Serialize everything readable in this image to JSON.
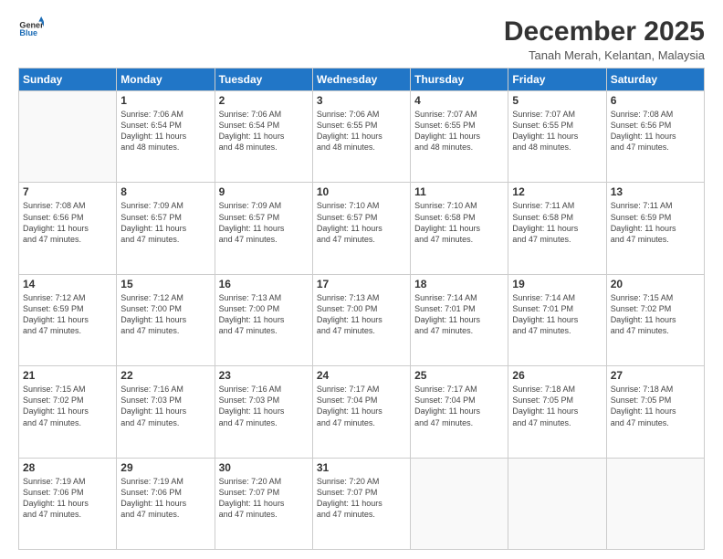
{
  "logo": {
    "line1": "General",
    "line2": "Blue"
  },
  "header": {
    "title": "December 2025",
    "subtitle": "Tanah Merah, Kelantan, Malaysia"
  },
  "weekdays": [
    "Sunday",
    "Monday",
    "Tuesday",
    "Wednesday",
    "Thursday",
    "Friday",
    "Saturday"
  ],
  "weeks": [
    [
      {
        "day": "",
        "info": ""
      },
      {
        "day": "1",
        "info": "Sunrise: 7:06 AM\nSunset: 6:54 PM\nDaylight: 11 hours\nand 48 minutes."
      },
      {
        "day": "2",
        "info": "Sunrise: 7:06 AM\nSunset: 6:54 PM\nDaylight: 11 hours\nand 48 minutes."
      },
      {
        "day": "3",
        "info": "Sunrise: 7:06 AM\nSunset: 6:55 PM\nDaylight: 11 hours\nand 48 minutes."
      },
      {
        "day": "4",
        "info": "Sunrise: 7:07 AM\nSunset: 6:55 PM\nDaylight: 11 hours\nand 48 minutes."
      },
      {
        "day": "5",
        "info": "Sunrise: 7:07 AM\nSunset: 6:55 PM\nDaylight: 11 hours\nand 48 minutes."
      },
      {
        "day": "6",
        "info": "Sunrise: 7:08 AM\nSunset: 6:56 PM\nDaylight: 11 hours\nand 47 minutes."
      }
    ],
    [
      {
        "day": "7",
        "info": "Sunrise: 7:08 AM\nSunset: 6:56 PM\nDaylight: 11 hours\nand 47 minutes."
      },
      {
        "day": "8",
        "info": "Sunrise: 7:09 AM\nSunset: 6:57 PM\nDaylight: 11 hours\nand 47 minutes."
      },
      {
        "day": "9",
        "info": "Sunrise: 7:09 AM\nSunset: 6:57 PM\nDaylight: 11 hours\nand 47 minutes."
      },
      {
        "day": "10",
        "info": "Sunrise: 7:10 AM\nSunset: 6:57 PM\nDaylight: 11 hours\nand 47 minutes."
      },
      {
        "day": "11",
        "info": "Sunrise: 7:10 AM\nSunset: 6:58 PM\nDaylight: 11 hours\nand 47 minutes."
      },
      {
        "day": "12",
        "info": "Sunrise: 7:11 AM\nSunset: 6:58 PM\nDaylight: 11 hours\nand 47 minutes."
      },
      {
        "day": "13",
        "info": "Sunrise: 7:11 AM\nSunset: 6:59 PM\nDaylight: 11 hours\nand 47 minutes."
      }
    ],
    [
      {
        "day": "14",
        "info": "Sunrise: 7:12 AM\nSunset: 6:59 PM\nDaylight: 11 hours\nand 47 minutes."
      },
      {
        "day": "15",
        "info": "Sunrise: 7:12 AM\nSunset: 7:00 PM\nDaylight: 11 hours\nand 47 minutes."
      },
      {
        "day": "16",
        "info": "Sunrise: 7:13 AM\nSunset: 7:00 PM\nDaylight: 11 hours\nand 47 minutes."
      },
      {
        "day": "17",
        "info": "Sunrise: 7:13 AM\nSunset: 7:00 PM\nDaylight: 11 hours\nand 47 minutes."
      },
      {
        "day": "18",
        "info": "Sunrise: 7:14 AM\nSunset: 7:01 PM\nDaylight: 11 hours\nand 47 minutes."
      },
      {
        "day": "19",
        "info": "Sunrise: 7:14 AM\nSunset: 7:01 PM\nDaylight: 11 hours\nand 47 minutes."
      },
      {
        "day": "20",
        "info": "Sunrise: 7:15 AM\nSunset: 7:02 PM\nDaylight: 11 hours\nand 47 minutes."
      }
    ],
    [
      {
        "day": "21",
        "info": "Sunrise: 7:15 AM\nSunset: 7:02 PM\nDaylight: 11 hours\nand 47 minutes."
      },
      {
        "day": "22",
        "info": "Sunrise: 7:16 AM\nSunset: 7:03 PM\nDaylight: 11 hours\nand 47 minutes."
      },
      {
        "day": "23",
        "info": "Sunrise: 7:16 AM\nSunset: 7:03 PM\nDaylight: 11 hours\nand 47 minutes."
      },
      {
        "day": "24",
        "info": "Sunrise: 7:17 AM\nSunset: 7:04 PM\nDaylight: 11 hours\nand 47 minutes."
      },
      {
        "day": "25",
        "info": "Sunrise: 7:17 AM\nSunset: 7:04 PM\nDaylight: 11 hours\nand 47 minutes."
      },
      {
        "day": "26",
        "info": "Sunrise: 7:18 AM\nSunset: 7:05 PM\nDaylight: 11 hours\nand 47 minutes."
      },
      {
        "day": "27",
        "info": "Sunrise: 7:18 AM\nSunset: 7:05 PM\nDaylight: 11 hours\nand 47 minutes."
      }
    ],
    [
      {
        "day": "28",
        "info": "Sunrise: 7:19 AM\nSunset: 7:06 PM\nDaylight: 11 hours\nand 47 minutes."
      },
      {
        "day": "29",
        "info": "Sunrise: 7:19 AM\nSunset: 7:06 PM\nDaylight: 11 hours\nand 47 minutes."
      },
      {
        "day": "30",
        "info": "Sunrise: 7:20 AM\nSunset: 7:07 PM\nDaylight: 11 hours\nand 47 minutes."
      },
      {
        "day": "31",
        "info": "Sunrise: 7:20 AM\nSunset: 7:07 PM\nDaylight: 11 hours\nand 47 minutes."
      },
      {
        "day": "",
        "info": ""
      },
      {
        "day": "",
        "info": ""
      },
      {
        "day": "",
        "info": ""
      }
    ]
  ]
}
